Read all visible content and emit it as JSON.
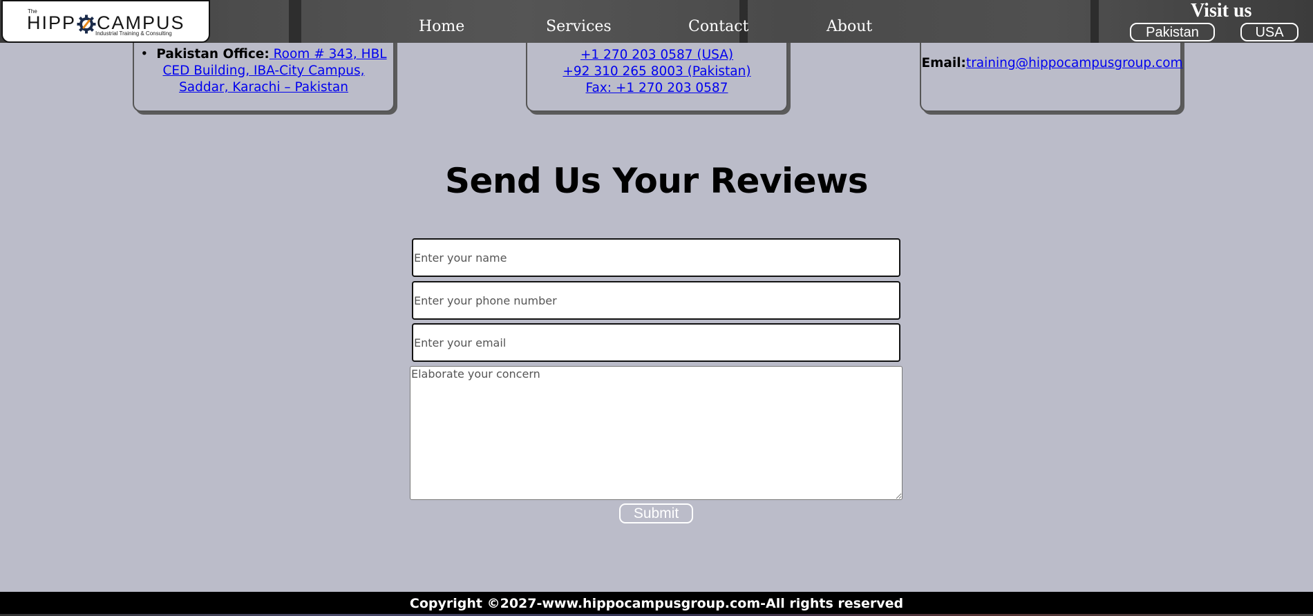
{
  "header": {
    "logo": {
      "the": "The",
      "left": "HIPP",
      "right": "CAMPUS",
      "tagline": "Industrial Training & Consulting"
    },
    "nav": [
      "Home",
      "Services",
      "Contact",
      "About"
    ],
    "visit_us": "Visit us",
    "countries": [
      "Pakistan",
      "USA"
    ]
  },
  "cards": {
    "pakistan": {
      "label": "Pakistan Office:",
      "address": " Room # 343, HBL CED Building, IBA-City Campus, Saddar, Karachi – Pakistan"
    },
    "phones": {
      "partial": "+1 270 203 0587 (USA)",
      "pk": "+92 310 265 8003 (Pakistan)",
      "fax": "Fax: +1 270 203 0587"
    },
    "email": {
      "label": "Email:",
      "value": "training@hippocampusgroup.com"
    }
  },
  "review": {
    "title": "Send Us Your Reviews",
    "name_placeholder": "Enter your name",
    "phone_placeholder": "Enter your phone number",
    "email_placeholder": "Enter your email",
    "concern_placeholder": "Elaborate your concern",
    "submit": "Submit"
  },
  "footer": {
    "copyright": "Copyright ©2027-www.hippocampusgroup.com-All rights reserved"
  }
}
